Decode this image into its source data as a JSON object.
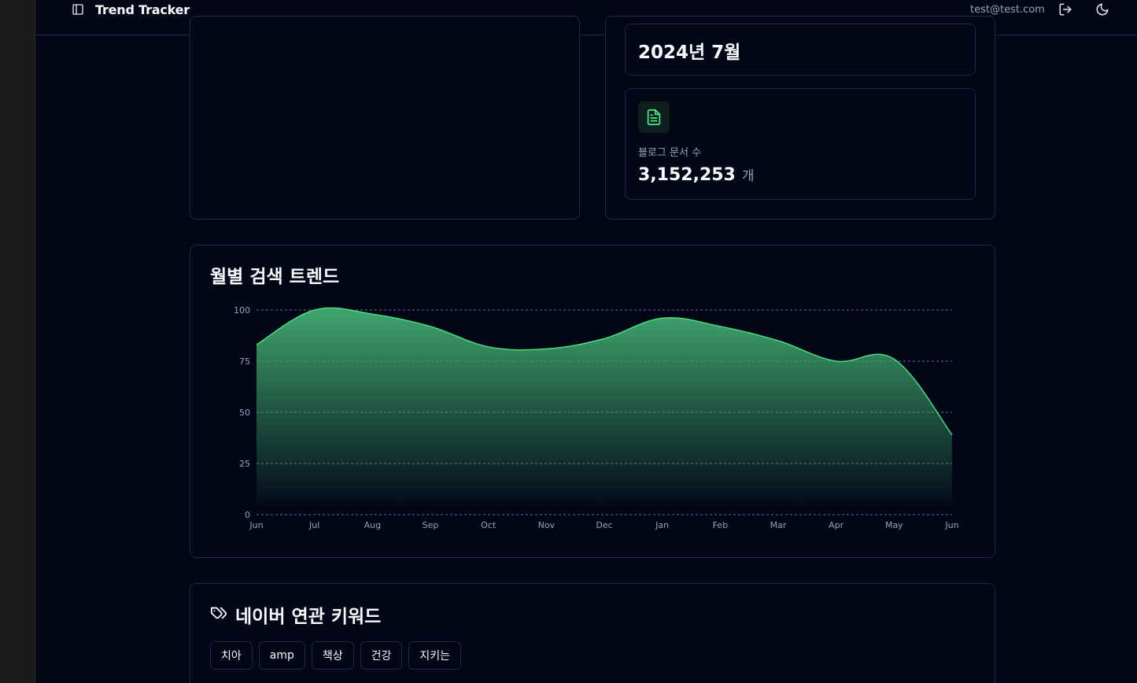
{
  "app": {
    "brand": "Trend Tracker",
    "user_email": "test@test.com",
    "icons": {
      "sidebar_toggle": "panel-left-icon",
      "logout": "log-out-icon",
      "theme": "moon-icon",
      "document": "file-text-icon",
      "tag": "tags-icon"
    }
  },
  "stats": {
    "period_value": "2024년 7월",
    "docs_label": "블로그 문서 수",
    "docs_value": "3,152,253",
    "docs_unit": "개"
  },
  "trend": {
    "title": "월별 검색 트렌드"
  },
  "keywords": {
    "title": "네이버 연관 키워드",
    "items": [
      "치아",
      "amp",
      "책상",
      "건강",
      "지키는"
    ]
  },
  "colors": {
    "accent": "#4ade80",
    "area_top": "#3fa56d",
    "background": "#020617",
    "border": "#1e293b",
    "muted_text": "#94a3b8"
  },
  "chart_data": {
    "type": "area",
    "title": "월별 검색 트렌드",
    "categories": [
      "Jun",
      "Jul",
      "Aug",
      "Sep",
      "Oct",
      "Nov",
      "Dec",
      "Jan",
      "Feb",
      "Mar",
      "Apr",
      "May",
      "Jun"
    ],
    "series": [
      {
        "values": [
          83,
          100,
          98,
          92,
          82,
          81,
          86,
          96,
          92,
          85,
          75,
          76,
          39
        ]
      }
    ],
    "ylim": [
      0,
      100
    ],
    "yticks": [
      0,
      25,
      50,
      75,
      100
    ],
    "grid": true,
    "grid_style": "dashed-horizontal",
    "curve": "smooth",
    "color": "#4ade80"
  }
}
